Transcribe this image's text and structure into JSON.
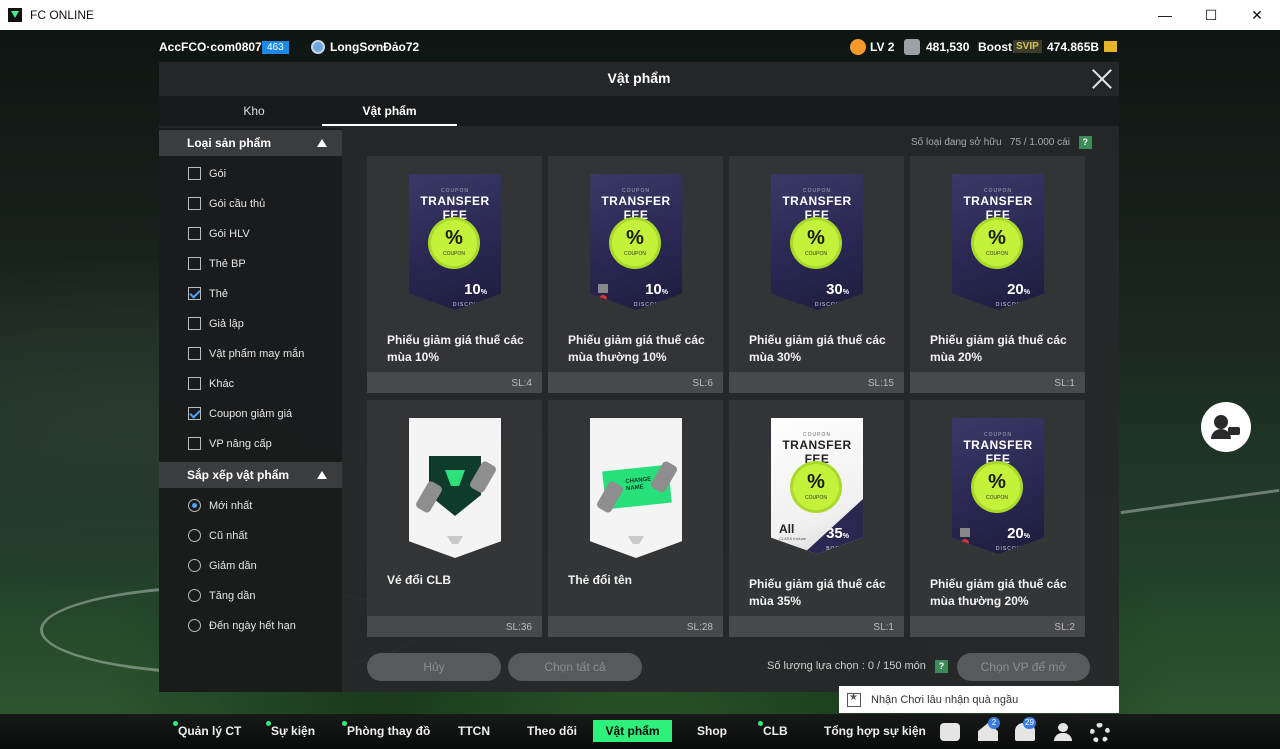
{
  "window": {
    "title": "FC ONLINE",
    "controls": [
      "—",
      "☐",
      "✕"
    ]
  },
  "topbar": {
    "account": "AccFCO·com0807g",
    "account_badge": "463",
    "club": "LongSơnĐảo72",
    "level": "LV 2",
    "coins": "481,530",
    "boost": "Boost",
    "svip": "SVIP",
    "bp": "474.865B"
  },
  "modal": {
    "title": "Vật phẩm",
    "tabs": [
      "Kho",
      "Vật phẩm"
    ],
    "owned_label": "Số loại đang sở hữu",
    "owned_value": "75 / 1.000 cái",
    "help": "?"
  },
  "sidebar": {
    "filter_header": "Loại sản phẩm",
    "filters": [
      {
        "label": "Gói",
        "checked": false
      },
      {
        "label": "Gói cầu thủ",
        "checked": false
      },
      {
        "label": "Gói HLV",
        "checked": false
      },
      {
        "label": "Thẻ BP",
        "checked": false
      },
      {
        "label": "Thẻ",
        "checked": true
      },
      {
        "label": "Giả lập",
        "checked": false
      },
      {
        "label": "Vật phẩm may mắn",
        "checked": false
      },
      {
        "label": "Khác",
        "checked": false
      },
      {
        "label": "Coupon giảm giá",
        "checked": true
      },
      {
        "label": "VP nâng cấp",
        "checked": false
      }
    ],
    "sort_header": "Sắp xếp vật phẩm",
    "sorts": [
      {
        "label": "Mới nhất",
        "selected": true
      },
      {
        "label": "Cũ nhất",
        "selected": false
      },
      {
        "label": "Giảm dần",
        "selected": false
      },
      {
        "label": "Tăng dần",
        "selected": false
      },
      {
        "label": "Đến ngày hết hạn",
        "selected": false
      }
    ]
  },
  "items": [
    {
      "name": "Phiếu giảm giá thuế các mùa 10%",
      "qty": "SL:4",
      "kind": "coupon",
      "coupon_tag": "COUPON",
      "coupon_title": "TRANSFER FEE",
      "seal": "%",
      "seal_sub": "COUPON",
      "discount": "10",
      "unit": "%",
      "discount_label": "DISCOUNT"
    },
    {
      "name": "Phiếu giảm giá thuế các mùa thường 10%",
      "qty": "SL:6",
      "kind": "coupon-normal",
      "coupon_tag": "COUPON",
      "coupon_title": "TRANSFER FEE",
      "seal": "%",
      "seal_sub": "COUPON",
      "discount": "10",
      "unit": "%",
      "discount_label": "DISCOUNT"
    },
    {
      "name": "Phiếu giảm giá thuế các mùa 30%",
      "qty": "SL:15",
      "kind": "coupon",
      "coupon_tag": "COUPON",
      "coupon_title": "TRANSFER FEE",
      "seal": "%",
      "seal_sub": "COUPON",
      "discount": "30",
      "unit": "%",
      "discount_label": "DISCOUNT"
    },
    {
      "name": "Phiếu giảm giá thuế các mùa 20%",
      "qty": "SL:1",
      "kind": "coupon",
      "coupon_tag": "COUPON",
      "coupon_title": "TRANSFER FEE",
      "seal": "%",
      "seal_sub": "COUPON",
      "discount": "20",
      "unit": "%",
      "discount_label": "DISCOUNT"
    },
    {
      "name": "Vé đổi CLB",
      "qty": "SL:36",
      "kind": "clb"
    },
    {
      "name": "Thẻ đổi tên",
      "qty": "SL:28",
      "kind": "rename",
      "card_text": "CHANGE NAME"
    },
    {
      "name": "Phiếu giảm giá thuế các mùa 35%",
      "qty": "SL:1",
      "kind": "coupon-white",
      "coupon_tag": "COUPON",
      "coupon_title": "TRANSFER FEE",
      "seal": "%",
      "seal_sub": "COUPON",
      "discount": "35",
      "unit": "%",
      "discount_label": "BONUS",
      "all_label": "All",
      "all_sub": "CLASS Include"
    },
    {
      "name": "Phiếu giảm giá thuế các mùa thường 20%",
      "qty": "SL:2",
      "kind": "coupon-normal",
      "coupon_tag": "COUPON",
      "coupon_title": "TRANSFER FEE",
      "seal": "%",
      "seal_sub": "COUPON",
      "discount": "20",
      "unit": "%",
      "discount_label": "DISCOUNT"
    }
  ],
  "footer": {
    "cancel": "Hủy",
    "select_all": "Chọn tất cả",
    "selected_count_label": "Số lượng lựa chọn : 0 / 150 món",
    "open": "Chọn VP để mở"
  },
  "notification": "Nhận Chơi lâu nhận quà ngầu",
  "nav": {
    "items": [
      "Quản lý CT",
      "Sự kiện",
      "Phòng thay đồ",
      "TTCN",
      "Theo dõi",
      "Vật phẩm",
      "Shop",
      "CLB",
      "Tổng hợp sự kiện"
    ],
    "home_badge": "2",
    "bell_badge": "29"
  }
}
